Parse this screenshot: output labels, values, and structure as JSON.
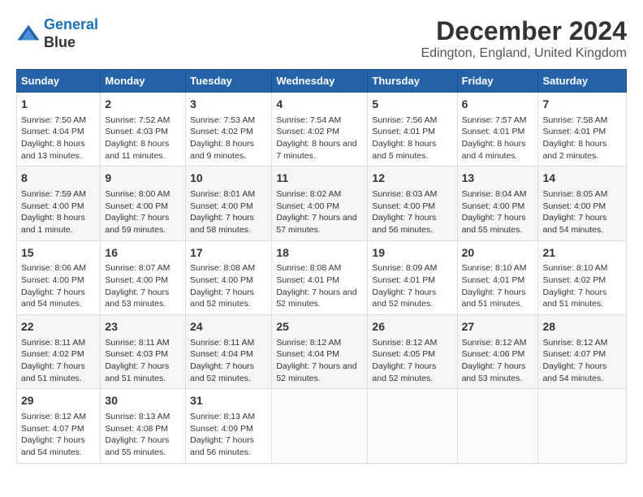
{
  "header": {
    "logo_line1": "General",
    "logo_line2": "Blue",
    "main_title": "December 2024",
    "subtitle": "Edington, England, United Kingdom"
  },
  "days_of_week": [
    "Sunday",
    "Monday",
    "Tuesday",
    "Wednesday",
    "Thursday",
    "Friday",
    "Saturday"
  ],
  "weeks": [
    [
      {
        "day": "1",
        "sunrise": "Sunrise: 7:50 AM",
        "sunset": "Sunset: 4:04 PM",
        "daylight": "Daylight: 8 hours and 13 minutes."
      },
      {
        "day": "2",
        "sunrise": "Sunrise: 7:52 AM",
        "sunset": "Sunset: 4:03 PM",
        "daylight": "Daylight: 8 hours and 11 minutes."
      },
      {
        "day": "3",
        "sunrise": "Sunrise: 7:53 AM",
        "sunset": "Sunset: 4:02 PM",
        "daylight": "Daylight: 8 hours and 9 minutes."
      },
      {
        "day": "4",
        "sunrise": "Sunrise: 7:54 AM",
        "sunset": "Sunset: 4:02 PM",
        "daylight": "Daylight: 8 hours and 7 minutes."
      },
      {
        "day": "5",
        "sunrise": "Sunrise: 7:56 AM",
        "sunset": "Sunset: 4:01 PM",
        "daylight": "Daylight: 8 hours and 5 minutes."
      },
      {
        "day": "6",
        "sunrise": "Sunrise: 7:57 AM",
        "sunset": "Sunset: 4:01 PM",
        "daylight": "Daylight: 8 hours and 4 minutes."
      },
      {
        "day": "7",
        "sunrise": "Sunrise: 7:58 AM",
        "sunset": "Sunset: 4:01 PM",
        "daylight": "Daylight: 8 hours and 2 minutes."
      }
    ],
    [
      {
        "day": "8",
        "sunrise": "Sunrise: 7:59 AM",
        "sunset": "Sunset: 4:00 PM",
        "daylight": "Daylight: 8 hours and 1 minute."
      },
      {
        "day": "9",
        "sunrise": "Sunrise: 8:00 AM",
        "sunset": "Sunset: 4:00 PM",
        "daylight": "Daylight: 7 hours and 59 minutes."
      },
      {
        "day": "10",
        "sunrise": "Sunrise: 8:01 AM",
        "sunset": "Sunset: 4:00 PM",
        "daylight": "Daylight: 7 hours and 58 minutes."
      },
      {
        "day": "11",
        "sunrise": "Sunrise: 8:02 AM",
        "sunset": "Sunset: 4:00 PM",
        "daylight": "Daylight: 7 hours and 57 minutes."
      },
      {
        "day": "12",
        "sunrise": "Sunrise: 8:03 AM",
        "sunset": "Sunset: 4:00 PM",
        "daylight": "Daylight: 7 hours and 56 minutes."
      },
      {
        "day": "13",
        "sunrise": "Sunrise: 8:04 AM",
        "sunset": "Sunset: 4:00 PM",
        "daylight": "Daylight: 7 hours and 55 minutes."
      },
      {
        "day": "14",
        "sunrise": "Sunrise: 8:05 AM",
        "sunset": "Sunset: 4:00 PM",
        "daylight": "Daylight: 7 hours and 54 minutes."
      }
    ],
    [
      {
        "day": "15",
        "sunrise": "Sunrise: 8:06 AM",
        "sunset": "Sunset: 4:00 PM",
        "daylight": "Daylight: 7 hours and 54 minutes."
      },
      {
        "day": "16",
        "sunrise": "Sunrise: 8:07 AM",
        "sunset": "Sunset: 4:00 PM",
        "daylight": "Daylight: 7 hours and 53 minutes."
      },
      {
        "day": "17",
        "sunrise": "Sunrise: 8:08 AM",
        "sunset": "Sunset: 4:00 PM",
        "daylight": "Daylight: 7 hours and 52 minutes."
      },
      {
        "day": "18",
        "sunrise": "Sunrise: 8:08 AM",
        "sunset": "Sunset: 4:01 PM",
        "daylight": "Daylight: 7 hours and 52 minutes."
      },
      {
        "day": "19",
        "sunrise": "Sunrise: 8:09 AM",
        "sunset": "Sunset: 4:01 PM",
        "daylight": "Daylight: 7 hours and 52 minutes."
      },
      {
        "day": "20",
        "sunrise": "Sunrise: 8:10 AM",
        "sunset": "Sunset: 4:01 PM",
        "daylight": "Daylight: 7 hours and 51 minutes."
      },
      {
        "day": "21",
        "sunrise": "Sunrise: 8:10 AM",
        "sunset": "Sunset: 4:02 PM",
        "daylight": "Daylight: 7 hours and 51 minutes."
      }
    ],
    [
      {
        "day": "22",
        "sunrise": "Sunrise: 8:11 AM",
        "sunset": "Sunset: 4:02 PM",
        "daylight": "Daylight: 7 hours and 51 minutes."
      },
      {
        "day": "23",
        "sunrise": "Sunrise: 8:11 AM",
        "sunset": "Sunset: 4:03 PM",
        "daylight": "Daylight: 7 hours and 51 minutes."
      },
      {
        "day": "24",
        "sunrise": "Sunrise: 8:11 AM",
        "sunset": "Sunset: 4:04 PM",
        "daylight": "Daylight: 7 hours and 52 minutes."
      },
      {
        "day": "25",
        "sunrise": "Sunrise: 8:12 AM",
        "sunset": "Sunset: 4:04 PM",
        "daylight": "Daylight: 7 hours and 52 minutes."
      },
      {
        "day": "26",
        "sunrise": "Sunrise: 8:12 AM",
        "sunset": "Sunset: 4:05 PM",
        "daylight": "Daylight: 7 hours and 52 minutes."
      },
      {
        "day": "27",
        "sunrise": "Sunrise: 8:12 AM",
        "sunset": "Sunset: 4:06 PM",
        "daylight": "Daylight: 7 hours and 53 minutes."
      },
      {
        "day": "28",
        "sunrise": "Sunrise: 8:12 AM",
        "sunset": "Sunset: 4:07 PM",
        "daylight": "Daylight: 7 hours and 54 minutes."
      }
    ],
    [
      {
        "day": "29",
        "sunrise": "Sunrise: 8:12 AM",
        "sunset": "Sunset: 4:07 PM",
        "daylight": "Daylight: 7 hours and 54 minutes."
      },
      {
        "day": "30",
        "sunrise": "Sunrise: 8:13 AM",
        "sunset": "Sunset: 4:08 PM",
        "daylight": "Daylight: 7 hours and 55 minutes."
      },
      {
        "day": "31",
        "sunrise": "Sunrise: 8:13 AM",
        "sunset": "Sunset: 4:09 PM",
        "daylight": "Daylight: 7 hours and 56 minutes."
      },
      null,
      null,
      null,
      null
    ]
  ]
}
